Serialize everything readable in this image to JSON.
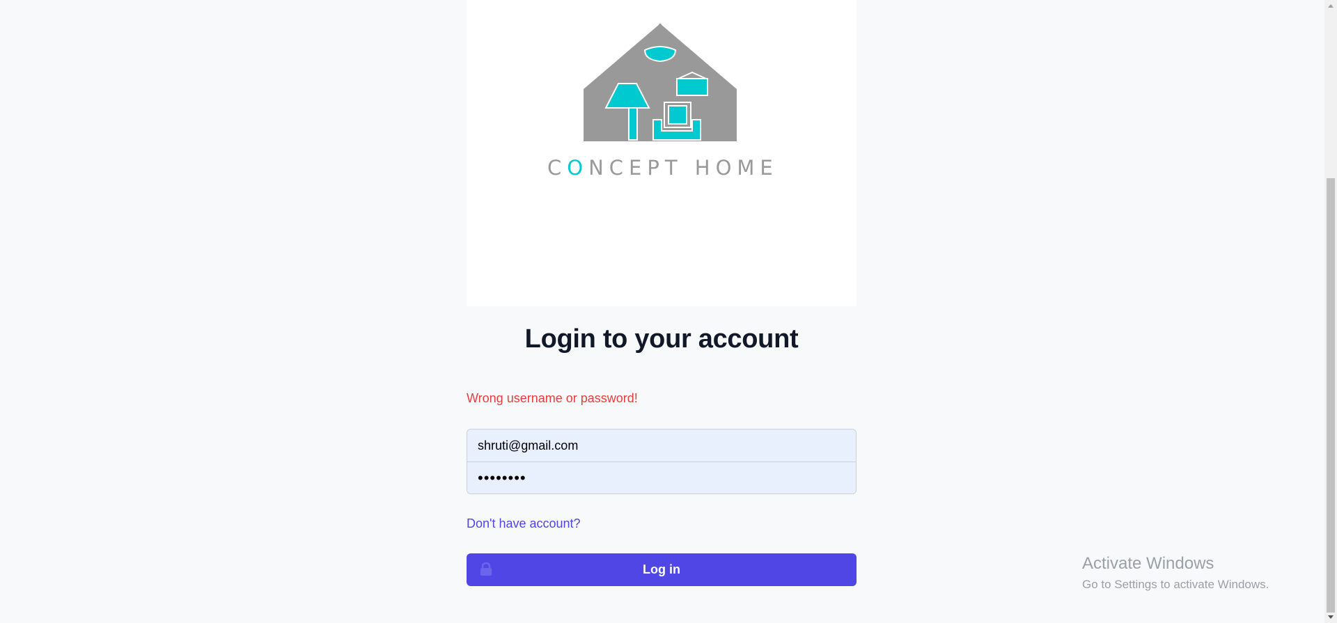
{
  "logo": {
    "text_prefix": "C",
    "text_highlight": "O",
    "text_rest": "NCEPT HOME",
    "colors": {
      "gray": "#999999",
      "teal": "#00c9d0"
    }
  },
  "login": {
    "title": "Login to your account",
    "error": "Wrong username or password!",
    "email_value": "shruti@gmail.com",
    "password_value": "shruti12",
    "signup_link": "Don't have account?",
    "submit_label": "Log in",
    "accent_color": "#4f46e5",
    "error_color": "#e53e3e"
  },
  "watermark": {
    "title": "Activate Windows",
    "subtitle": "Go to Settings to activate Windows."
  }
}
